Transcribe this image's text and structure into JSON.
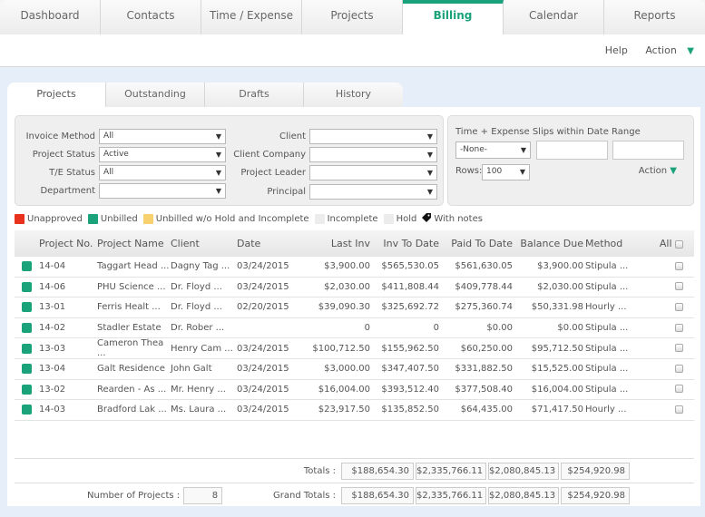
{
  "nav": {
    "tabs": [
      "Dashboard",
      "Contacts",
      "Time / Expense",
      "Projects",
      "Billing",
      "Calendar",
      "Reports"
    ],
    "active": "Billing"
  },
  "subbar": {
    "help": "Help",
    "action": "Action"
  },
  "subtabs": [
    "Projects",
    "Outstanding",
    "Drafts",
    "History"
  ],
  "filters": {
    "invoice_method": {
      "label": "Invoice Method",
      "value": "All"
    },
    "project_status": {
      "label": "Project Status",
      "value": "Active"
    },
    "te_status": {
      "label": "T/E Status",
      "value": "All"
    },
    "department": {
      "label": "Department",
      "value": ""
    },
    "client": {
      "label": "Client",
      "value": ""
    },
    "client_company": {
      "label": "Client Company",
      "value": ""
    },
    "project_leader": {
      "label": "Project Leader",
      "value": ""
    },
    "principal": {
      "label": "Principal",
      "value": ""
    }
  },
  "te_range": {
    "title": "Time + Expense Slips within Date Range",
    "range_value": "-None-",
    "start": "",
    "end": "",
    "rows_label": "Rows:",
    "rows_value": "100",
    "action": "Action"
  },
  "legend": [
    {
      "label": "Unapproved",
      "color": "#e8321e"
    },
    {
      "label": "Unbilled",
      "color": "#1aa37a"
    },
    {
      "label": "Unbilled w/o Hold and Incomplete",
      "color": "#f7d16e"
    },
    {
      "label": "Incomplete",
      "color": "#ececec"
    },
    {
      "label": "Hold",
      "color": "#ececec"
    },
    {
      "label": "With notes",
      "icon": "tag-icon"
    }
  ],
  "table": {
    "headers": [
      "Project No.",
      "Project Name",
      "Client",
      "Date",
      "Last Inv",
      "Inv To Date",
      "Paid To Date",
      "Balance Due",
      "Method",
      "All"
    ],
    "rows": [
      [
        "14-04",
        "Taggart Head ...",
        "Dagny Tag ...",
        "03/24/2015",
        "$3,900.00",
        "$565,530.05",
        "$561,630.05",
        "$3,900.00",
        "Stipula ..."
      ],
      [
        "14-06",
        "PHU Science ...",
        "Dr. Floyd ...",
        "03/24/2015",
        "$2,030.00",
        "$411,808.44",
        "$409,778.44",
        "$2,030.00",
        "Stipula ..."
      ],
      [
        "13-01",
        "Ferris Healt ...",
        "Dr. Floyd ...",
        "02/20/2015",
        "$39,090.30",
        "$325,692.72",
        "$275,360.74",
        "$50,331.98",
        "Hourly ..."
      ],
      [
        "14-02",
        "Stadler Estate",
        "Dr. Rober ...",
        "",
        "0",
        "0",
        "$0.00",
        "$0.00",
        "Stipula ..."
      ],
      [
        "13-03",
        "Cameron Thea ...",
        "Henry Cam ...",
        "03/24/2015",
        "$100,712.50",
        "$155,962.50",
        "$60,250.00",
        "$95,712.50",
        "Stipula ..."
      ],
      [
        "13-04",
        "Galt Residence",
        "John Galt",
        "03/24/2015",
        "$3,000.00",
        "$347,407.50",
        "$331,882.50",
        "$15,525.00",
        "Stipula ..."
      ],
      [
        "13-02",
        "Rearden - As ...",
        "Mr. Henry ...",
        "03/24/2015",
        "$16,004.00",
        "$393,512.40",
        "$377,508.40",
        "$16,004.00",
        "Stipula ..."
      ],
      [
        "14-03",
        "Bradford Lak ...",
        "Ms. Laura ...",
        "03/24/2015",
        "$23,917.50",
        "$135,852.50",
        "$64,435.00",
        "$71,417.50",
        "Hourly ..."
      ]
    ]
  },
  "totals": {
    "label": "Totals :",
    "values": [
      "$188,654.30",
      "$2,335,766.11",
      "$2,080,845.13",
      "$254,920.98"
    ]
  },
  "grand_totals": {
    "label": "Grand Totals :",
    "values": [
      "$188,654.30",
      "$2,335,766.11",
      "$2,080,845.13",
      "$254,920.98"
    ]
  },
  "project_count": {
    "label": "Number of Projects :",
    "value": "8"
  },
  "colors": {
    "accent": "#1aa37a"
  }
}
